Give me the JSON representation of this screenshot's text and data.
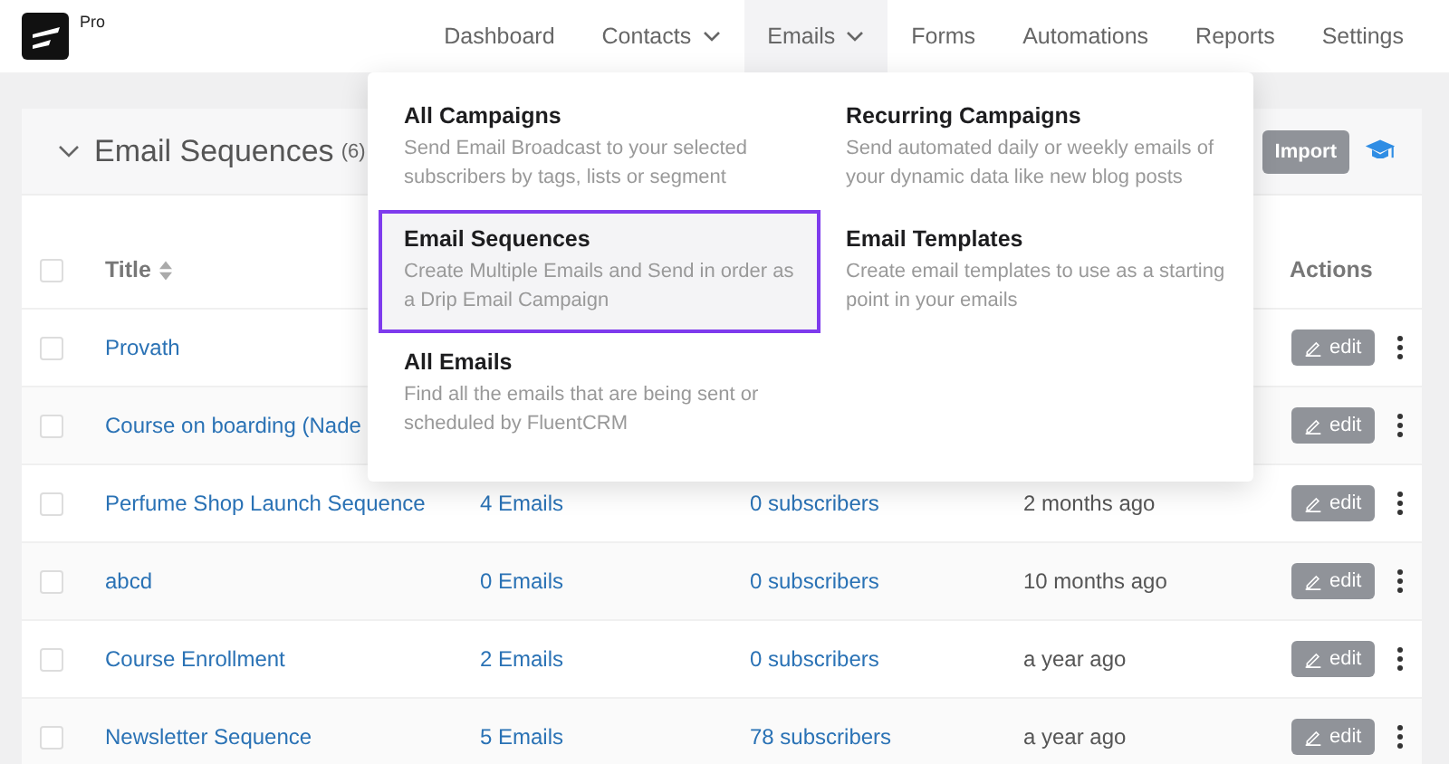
{
  "brand": {
    "badge": "Pro"
  },
  "nav": [
    {
      "label": "Dashboard",
      "selected": false,
      "has_dropdown": false
    },
    {
      "label": "Contacts",
      "selected": false,
      "has_dropdown": true
    },
    {
      "label": "Emails",
      "selected": true,
      "has_dropdown": true
    },
    {
      "label": "Forms",
      "selected": false,
      "has_dropdown": false
    },
    {
      "label": "Automations",
      "selected": false,
      "has_dropdown": false
    },
    {
      "label": "Reports",
      "selected": false,
      "has_dropdown": false
    },
    {
      "label": "Settings",
      "selected": false,
      "has_dropdown": false
    }
  ],
  "card": {
    "title": "Email Sequences",
    "count": "(6)",
    "import_button": "Import"
  },
  "table": {
    "columns": [
      "Title",
      "Actions"
    ],
    "select_all_checked": false,
    "rows": [
      {
        "title": "Provath",
        "edit": "edit",
        "checked": false
      },
      {
        "title": "Course on boarding (Nade",
        "edit": "edit",
        "checked": false
      },
      {
        "title": "Perfume Shop Launch Sequence",
        "emails": "4 Emails",
        "subscribers": "0 subscribers",
        "updated": "2 months ago",
        "edit": "edit",
        "checked": false
      },
      {
        "title": "abcd",
        "emails": "0 Emails",
        "subscribers": "0 subscribers",
        "updated": "10 months ago",
        "edit": "edit",
        "checked": false
      },
      {
        "title": "Course Enrollment",
        "emails": "2 Emails",
        "subscribers": "0 subscribers",
        "updated": "a year ago",
        "edit": "edit",
        "checked": false
      },
      {
        "title": "Newsletter Sequence",
        "emails": "5 Emails",
        "subscribers": "78 subscribers",
        "updated": "a year ago",
        "edit": "edit",
        "checked": false
      }
    ]
  },
  "dropdown": {
    "items": [
      {
        "title": "All Campaigns",
        "description": "Send Email Broadcast to your selected subscribers by tags, lists or segment",
        "selected": false
      },
      {
        "title": "Recurring Campaigns",
        "description": "Send automated daily or weekly emails of your dynamic data like new blog posts",
        "selected": false
      },
      {
        "title": "Email Sequences",
        "description": "Create Multiple Emails and Send in order as a Drip Email Campaign",
        "selected": true
      },
      {
        "title": "Email Templates",
        "description": "Create email templates to use as a starting point in your emails",
        "selected": false
      },
      {
        "title": "All Emails",
        "description": "Find all the emails that are being sent or scheduled by FluentCRM",
        "selected": false
      }
    ]
  }
}
